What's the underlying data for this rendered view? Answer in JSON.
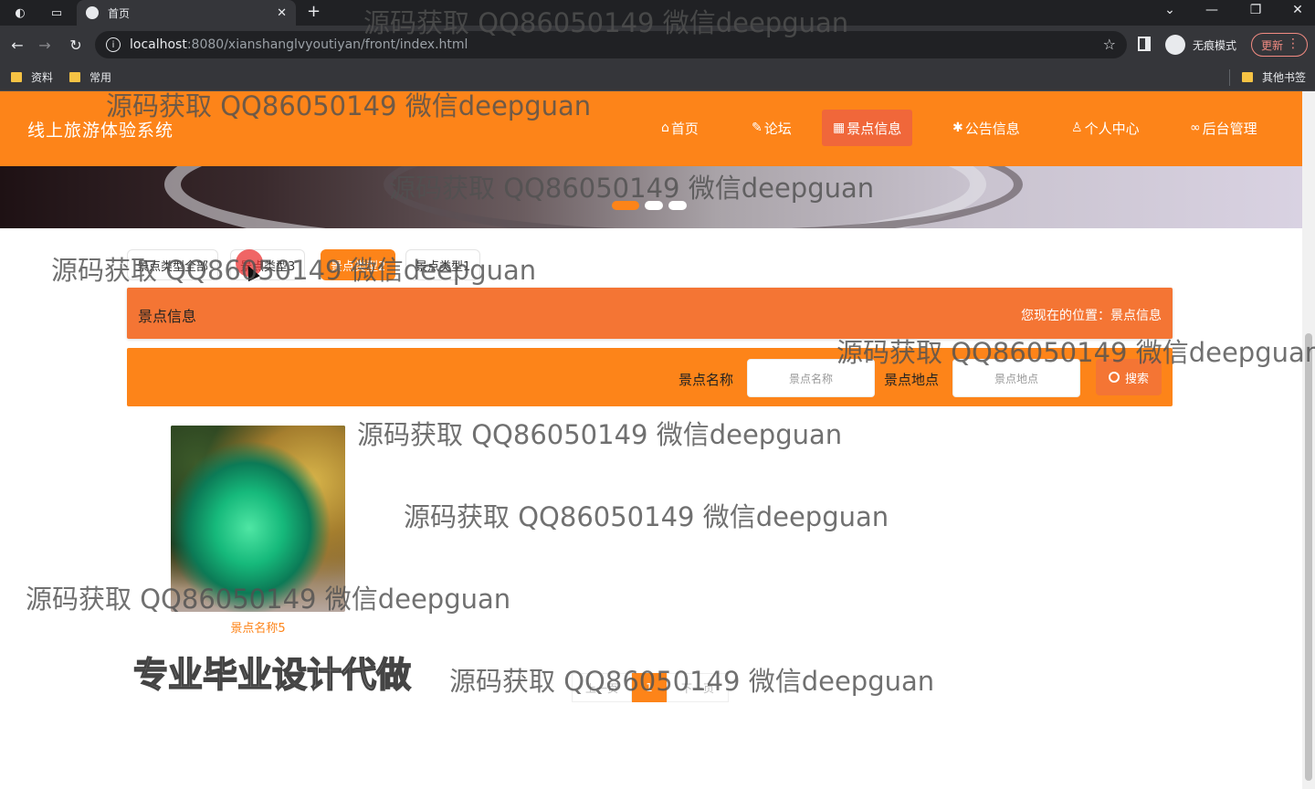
{
  "browser": {
    "tab_title": "首页",
    "url_host": "localhost",
    "url_rest": ":8080/xianshanglvyoutiyan/front/index.html",
    "incognito_label": "无痕模式",
    "update_label": "更新",
    "bookmarks": [
      "资料",
      "常用"
    ],
    "other_bookmarks": "其他书签"
  },
  "site": {
    "title": "线上旅游体验系统",
    "nav": [
      {
        "icon": "home-icon",
        "glyph": "⌂",
        "label": "首页"
      },
      {
        "icon": "forum-icon",
        "glyph": "✎",
        "label": "论坛"
      },
      {
        "icon": "grid-icon",
        "glyph": "▦",
        "label": "景点信息"
      },
      {
        "icon": "snowflake-icon",
        "glyph": "✱",
        "label": "公告信息"
      },
      {
        "icon": "user-icon",
        "glyph": "♙",
        "label": "个人中心"
      },
      {
        "icon": "link-icon",
        "glyph": "∞",
        "label": "后台管理"
      }
    ]
  },
  "categories": [
    "景点类型全部",
    "景点类型3",
    "景点类型2",
    "景点类型1"
  ],
  "section": {
    "title": "景点信息",
    "location_label": "您现在的位置：景点信息"
  },
  "search": {
    "name_label": "景点名称",
    "name_placeholder": "景点名称",
    "place_label": "景点地点",
    "place_placeholder": "景点地点",
    "button_label": "搜索"
  },
  "items": [
    {
      "name": "景点名称5"
    }
  ],
  "pagination": {
    "prev": "上一页",
    "current": "1",
    "next": "下一页"
  },
  "watermark": "源码获取 QQ86050149 微信deepguan",
  "promo_text": "专业毕业设计代做",
  "colors": {
    "brand_orange": "#fd8419",
    "active_orange": "#f0673a"
  }
}
